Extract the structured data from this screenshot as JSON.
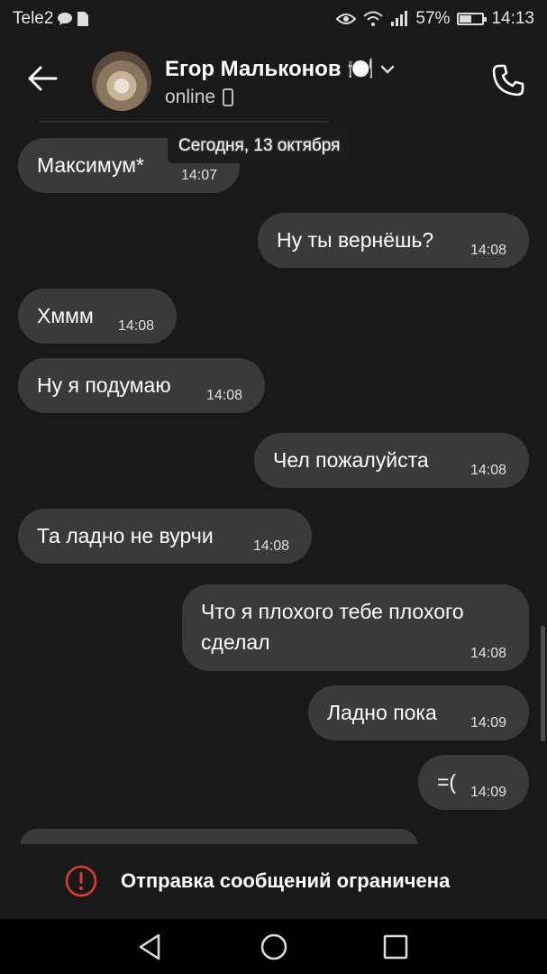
{
  "status_bar": {
    "carrier": "Tele2",
    "battery_percent": "57%",
    "battery_level": 0.57,
    "time": "14:13"
  },
  "header": {
    "contact_name": "Егор Мальконов 🍽️",
    "presence": "online"
  },
  "chat": {
    "date_divider": "Сегодня, 13 октября",
    "messages": [
      {
        "side": "incoming",
        "text": "Максимум*",
        "time": "14:07"
      },
      {
        "side": "outgoing",
        "text": "Ну ты вернёшь?",
        "time": "14:08"
      },
      {
        "side": "incoming",
        "text": "Хммм",
        "time": "14:08"
      },
      {
        "side": "incoming",
        "text": "Ну я подумаю",
        "time": "14:08"
      },
      {
        "side": "outgoing",
        "text": "Чел пожалуйста",
        "time": "14:08"
      },
      {
        "side": "incoming",
        "text": "Та ладно не вурчи",
        "time": "14:08"
      },
      {
        "side": "outgoing",
        "text_line1": "Что я плохого тебе плохого",
        "text_line2": "сделал",
        "time": "14:08"
      },
      {
        "side": "outgoing",
        "text": "Ладно пока",
        "time": "14:09"
      },
      {
        "side": "outgoing",
        "text": "=(",
        "time": "14:09"
      }
    ]
  },
  "banner": {
    "text": "Отправка сообщений ограничена",
    "icon": "alert-circle-icon",
    "accent_color": "#e53935"
  },
  "navbar": {
    "icons": [
      "back-triangle-icon",
      "home-circle-icon",
      "recent-square-icon"
    ]
  }
}
